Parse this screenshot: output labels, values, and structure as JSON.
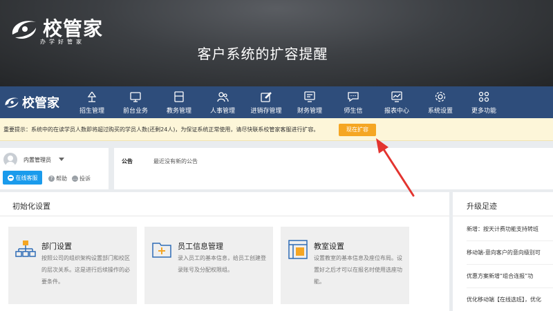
{
  "banner": {
    "brand": "校管家",
    "slogan": "办学好管家",
    "headline": "客户系统的扩容提醒"
  },
  "nav": {
    "brand": "校管家",
    "items": [
      {
        "label": "招生管理",
        "icon": "megaphone-icon"
      },
      {
        "label": "前台业务",
        "icon": "monitor-icon"
      },
      {
        "label": "教务管理",
        "icon": "book-icon"
      },
      {
        "label": "人事管理",
        "icon": "people-icon"
      },
      {
        "label": "进销存管理",
        "icon": "edit-icon"
      },
      {
        "label": "财务管理",
        "icon": "finance-icon"
      },
      {
        "label": "师生信",
        "icon": "message-icon"
      },
      {
        "label": "报表中心",
        "icon": "report-icon"
      },
      {
        "label": "系统设置",
        "icon": "gear-icon"
      },
      {
        "label": "更多功能",
        "icon": "more-icon"
      }
    ]
  },
  "notice": {
    "text": "重要提示：系统中的在读学员人数即将超过购买的学员人数(还剩24人)，为保证系统正常使用，请尽快联系校管家客服进行扩容。",
    "button": "现在扩容"
  },
  "user": {
    "name": "内置管理员",
    "service_button": "在线客服",
    "help": "帮助",
    "complain": "投诉"
  },
  "announcement": {
    "label": "公告",
    "text": "最近没有新的公告"
  },
  "init_panel": {
    "title": "初始化设置",
    "cards": [
      {
        "title": "部门设置",
        "desc": "按照公司的组织架构设置部门和校区的层次关系。这是进行后续操作的必要条件。",
        "icon": "org-chart-icon"
      },
      {
        "title": "员工信息管理",
        "desc": "录入员工的基本信息，给员工创建登录账号及分配权限组。",
        "icon": "folder-add-icon"
      },
      {
        "title": "教室设置",
        "desc": "设置教室的基本信息及座位布局。设置好之后才可以在报名时使用选座功能。",
        "icon": "classroom-icon"
      }
    ]
  },
  "upgrade_panel": {
    "title": "升级足迹",
    "items": [
      "新增：按天计费功能支持转班",
      "移动端-意向客户的意向级别可",
      "优惠方案新增“组合连报”功",
      "优化移动端【在线选班】，优化"
    ]
  },
  "colors": {
    "nav_bg": "#2e4d7b",
    "accent_orange": "#f5a623",
    "service_blue": "#1a9bec",
    "arrow_red": "#e3342f"
  }
}
